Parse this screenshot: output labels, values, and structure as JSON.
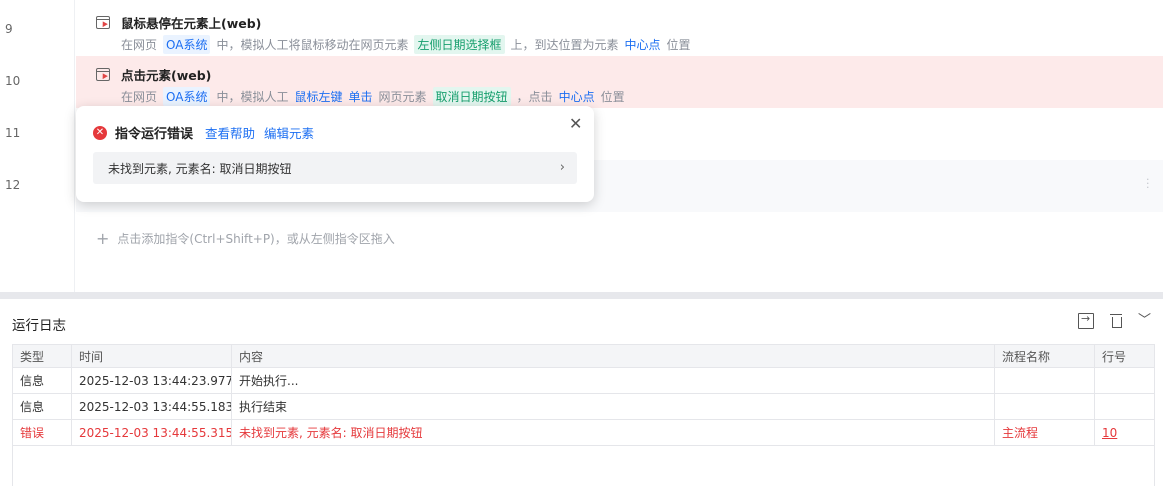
{
  "editor": {
    "rows": [
      {
        "line": "9",
        "title": "鼠标悬停在元素上(web)",
        "desc": [
          {
            "t": "在网页",
            "s": "plain"
          },
          {
            "t": "OA系统",
            "s": "tag-blue"
          },
          {
            "t": "中，模拟人工将鼠标移动在网页元素",
            "s": "plain"
          },
          {
            "t": "左侧日期选择框",
            "s": "tag-green"
          },
          {
            "t": "上，到达位置为元素",
            "s": "plain"
          },
          {
            "t": "中心点",
            "s": "txt-blue"
          },
          {
            "t": "位置",
            "s": "plain"
          }
        ]
      },
      {
        "line": "10",
        "title": "点击元素(web)",
        "desc": [
          {
            "t": "在网页",
            "s": "plain"
          },
          {
            "t": "OA系统",
            "s": "tag-blue"
          },
          {
            "t": "中，模拟人工",
            "s": "plain"
          },
          {
            "t": "鼠标左键",
            "s": "txt-blue"
          },
          {
            "t": "单击",
            "s": "txt-blue"
          },
          {
            "t": "网页元素",
            "s": "plain"
          },
          {
            "t": "取消日期按钮",
            "s": "tag-green"
          },
          {
            "t": "，点击",
            "s": "plain"
          },
          {
            "t": "中心点",
            "s": "txt-blue"
          },
          {
            "t": "位置",
            "s": "plain"
          }
        ]
      },
      {
        "line": "11"
      },
      {
        "line": "12"
      }
    ],
    "add_hint": "点击添加指令(Ctrl+Shift+P)，或从左侧指令区拖入"
  },
  "popover": {
    "title": "指令运行错误",
    "help_link": "查看帮助",
    "edit_link": "编辑元素",
    "message": "未找到元素, 元素名: 取消日期按钮"
  },
  "log": {
    "title": "运行日志",
    "columns": [
      "类型",
      "时间",
      "内容",
      "流程名称",
      "行号"
    ],
    "rows": [
      {
        "type": "信息",
        "time": "2025-12-03 13:44:23.977",
        "content": "开始执行...",
        "flow": "",
        "line": "",
        "error": false
      },
      {
        "type": "信息",
        "time": "2025-12-03 13:44:55.183",
        "content": "执行结束",
        "flow": "",
        "line": "",
        "error": false
      },
      {
        "type": "错误",
        "time": "2025-12-03 13:44:55.315",
        "content": "未找到元素, 元素名: 取消日期按钮",
        "flow": "主流程",
        "line": "10",
        "error": true
      }
    ]
  },
  "icons": {
    "error": "error-circle-icon",
    "close": "close-icon",
    "chevron": "chevron-right-icon",
    "export": "export-log-icon",
    "trash": "trash-icon",
    "collapse": "chevron-down-icon",
    "add": "plus-icon",
    "command": "web-command-icon"
  },
  "colors": {
    "accent": "#1d6ff2",
    "error": "#e5383b",
    "element_tag": "#159e6c",
    "error_row_bg": "#fdeaea"
  }
}
